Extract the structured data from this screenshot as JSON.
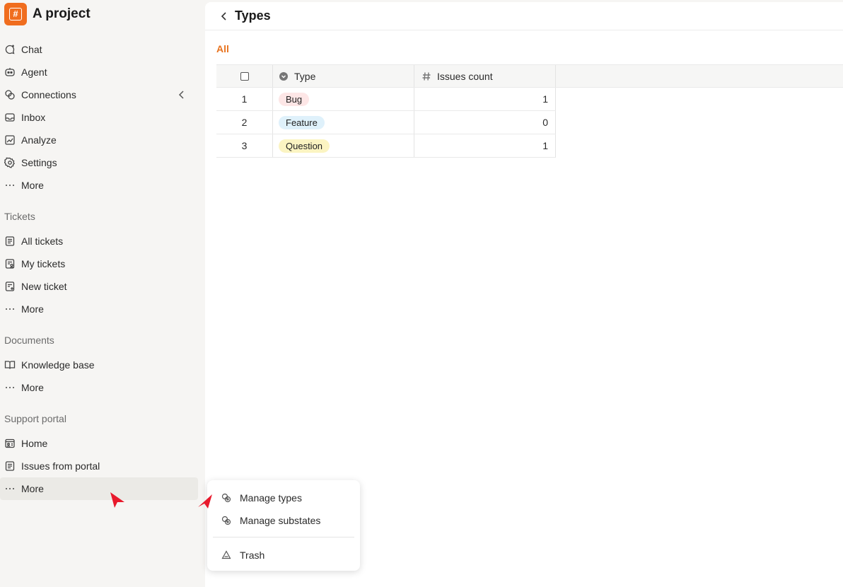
{
  "app": {
    "title": "A project",
    "logo_glyph": "#"
  },
  "sidebar": {
    "main_items": [
      {
        "label": "Chat",
        "icon": "chat-icon"
      },
      {
        "label": "Agent",
        "icon": "agent-icon"
      },
      {
        "label": "Connections",
        "icon": "connections-icon"
      },
      {
        "label": "Inbox",
        "icon": "inbox-icon"
      },
      {
        "label": "Analyze",
        "icon": "analyze-icon"
      },
      {
        "label": "Settings",
        "icon": "settings-icon"
      },
      {
        "label": "More",
        "icon": "more-icon"
      }
    ],
    "sections": [
      {
        "label": "Tickets",
        "items": [
          {
            "label": "All tickets",
            "icon": "ticket-list-icon"
          },
          {
            "label": "My tickets",
            "icon": "my-tickets-icon"
          },
          {
            "label": "New ticket",
            "icon": "new-ticket-icon"
          },
          {
            "label": "More",
            "icon": "more-icon"
          }
        ]
      },
      {
        "label": "Documents",
        "items": [
          {
            "label": "Knowledge base",
            "icon": "book-icon"
          },
          {
            "label": "More",
            "icon": "more-icon"
          }
        ]
      },
      {
        "label": "Support portal",
        "items": [
          {
            "label": "Home",
            "icon": "portal-home-icon"
          },
          {
            "label": "Issues from portal",
            "icon": "ticket-list-icon"
          },
          {
            "label": "More",
            "icon": "more-icon"
          }
        ]
      }
    ]
  },
  "main": {
    "title": "Types",
    "tabs": [
      {
        "label": "All",
        "active": true
      }
    ],
    "table": {
      "columns": [
        {
          "label": "Type",
          "icon": "select-field-icon"
        },
        {
          "label": "Issues count",
          "icon": "hash-icon"
        }
      ],
      "rows": [
        {
          "index": "1",
          "type": "Bug",
          "color": "#fde6e6",
          "count": "1"
        },
        {
          "index": "2",
          "type": "Feature",
          "color": "#dff1fb",
          "count": "0"
        },
        {
          "index": "3",
          "type": "Question",
          "color": "#fbf4c2",
          "count": "1"
        }
      ]
    }
  },
  "context_menu": {
    "items": [
      {
        "label": "Manage types",
        "icon": "manage-icon"
      },
      {
        "label": "Manage substates",
        "icon": "manage-icon"
      },
      {
        "label": "Trash",
        "icon": "trash-icon"
      }
    ]
  },
  "colors": {
    "accent": "#f06d1e",
    "tab_active": "#e8731f",
    "cursor": "#e8192c"
  }
}
